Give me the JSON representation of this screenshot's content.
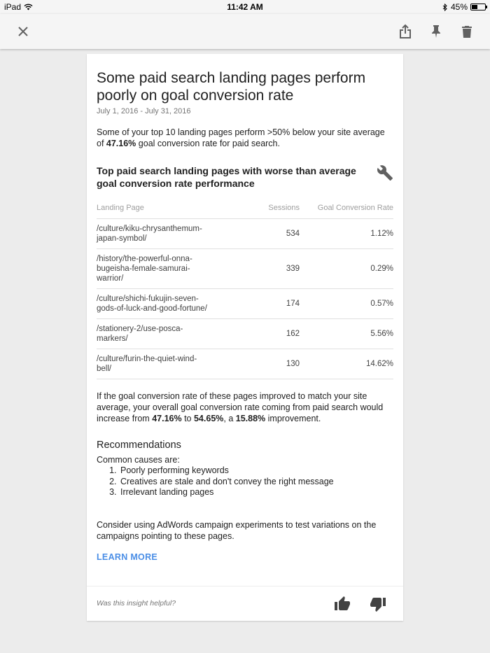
{
  "status_bar": {
    "device": "iPad",
    "time": "11:42 AM",
    "battery": "45%",
    "battery_level": 0.45
  },
  "app_bar": {
    "icons": [
      "close-icon",
      "share-icon",
      "pin-icon",
      "delete-icon"
    ]
  },
  "insight": {
    "title": "Some paid search landing pages perform poorly on goal conversion rate",
    "date_range": "July 1, 2016 - July 31, 2016",
    "summary_prefix": "Some of your top 10 landing pages perform >50% below your site average of ",
    "summary_value": "47.16%",
    "summary_suffix": " goal conversion rate for paid search.",
    "table_title": "Top paid search landing pages with worse than average goal conversion rate performance",
    "table": {
      "headers": [
        "Landing Page",
        "Sessions",
        "Goal Conversion Rate"
      ],
      "rows": [
        {
          "page": "/culture/kiku-chrysanthemum-japan-symbol/",
          "sessions": "534",
          "rate": "1.12%"
        },
        {
          "page": "/history/the-powerful-onna-bugeisha-female-samurai-warrior/",
          "sessions": "339",
          "rate": "0.29%"
        },
        {
          "page": "/culture/shichi-fukujin-seven-gods-of-luck-and-good-fortune/",
          "sessions": "174",
          "rate": "0.57%"
        },
        {
          "page": "/stationery-2/use-posca-markers/",
          "sessions": "162",
          "rate": "5.56%"
        },
        {
          "page": "/culture/furin-the-quiet-wind-bell/",
          "sessions": "130",
          "rate": "14.62%"
        }
      ]
    },
    "impact": {
      "text1": "If the goal conversion rate of these pages improved to match your site average, your overall goal conversion rate coming from paid search would increase from ",
      "from": "47.16%",
      "text2": " to ",
      "to": "54.65%",
      "text3": ", a ",
      "improvement": "15.88%",
      "text4": " improvement."
    },
    "recommendations": {
      "title": "Recommendations",
      "intro": "Common causes are:",
      "items": [
        "Poorly performing keywords",
        "Creatives are stale and don't convey the right message",
        "Irrelevant landing pages"
      ]
    },
    "consider": "Consider using AdWords campaign experiments to test variations on the campaigns pointing to these pages.",
    "learn_more": "LEARN MORE",
    "feedback_prompt": "Was this insight helpful?"
  },
  "colors": {
    "accent": "#4a8ee6",
    "background": "#ececec",
    "icon": "#616161"
  }
}
